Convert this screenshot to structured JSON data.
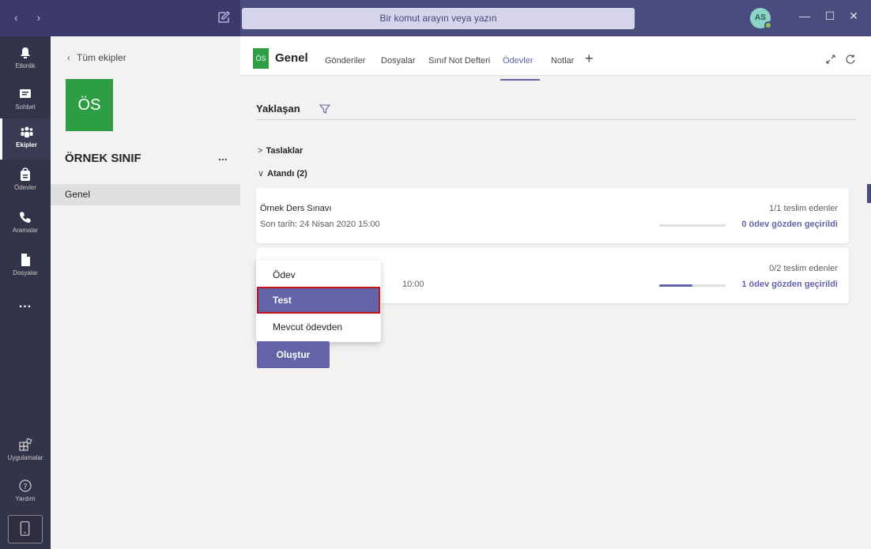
{
  "titlebar": {
    "search_placeholder": "Bir komut arayın veya yazın",
    "avatar_initials": "AS"
  },
  "rail": {
    "items": [
      {
        "label": "Etkinlik",
        "icon": "bell-icon"
      },
      {
        "label": "Sohbet",
        "icon": "chat-icon"
      },
      {
        "label": "Ekipler",
        "icon": "teams-icon"
      },
      {
        "label": "Ödevler",
        "icon": "assignments-icon"
      },
      {
        "label": "Aramalar",
        "icon": "phone-icon"
      },
      {
        "label": "Dosyalar",
        "icon": "files-icon"
      }
    ],
    "more": "...",
    "apps_label": "Uygulamalar",
    "help_label": "Yardım"
  },
  "team": {
    "back_label": "Tüm ekipler",
    "tile_initials": "ÖS",
    "name": "ÖRNEK SINIF",
    "more": "...",
    "channel": "Genel"
  },
  "channel_header": {
    "badge": "ÖS",
    "title": "Genel",
    "tabs": [
      "Gönderiler",
      "Dosyalar",
      "Sınıf Not Defteri",
      "Ödevler",
      "Notlar"
    ],
    "active_tab": "Ödevler",
    "add_tab": "+"
  },
  "assignments": {
    "filter_label": "Yaklaşan",
    "sections": [
      {
        "label": "Taslaklar",
        "chevron": ">"
      },
      {
        "label": "Atandı (2)",
        "chevron": "∨"
      }
    ],
    "cards": [
      {
        "name": "Örnek Ders Sınavı",
        "due": "Son tarih: 24 Nisan 2020 15:00",
        "submitted": "1/1 teslim edenler",
        "reviewed": "0 ödev gözden geçirildi",
        "progress": 0.0
      },
      {
        "name": "",
        "due": "10:00",
        "submitted": "0/2 teslim edenler",
        "reviewed": "1 ödev gözden geçirildi",
        "progress": 0.5
      }
    ]
  },
  "create_menu": {
    "items": [
      "Ödev",
      "Test",
      "Mevcut ödevden"
    ],
    "selected": "Test",
    "button_label": "Oluştur"
  },
  "colors": {
    "accent": "#6264a7",
    "titlebar": "#4b4c7e",
    "rail": "#33344a",
    "team_tile": "#2e9e45",
    "highlight_border": "#c4121c"
  }
}
